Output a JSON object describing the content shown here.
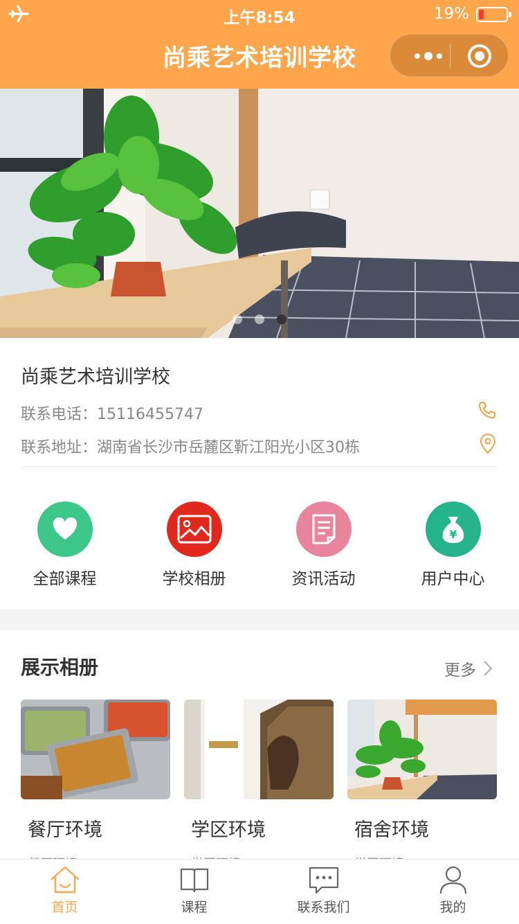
{
  "status_bar": {
    "time": "上午8:54",
    "battery": "19%",
    "battery_level": 0.19
  },
  "navbar": {
    "title": "尚乘艺术培训学校"
  },
  "colors": {
    "accent": "#ffa64d",
    "green": "#3cc68a",
    "red": "#e0281c",
    "pink": "#e8849b",
    "teal": "#25b38b"
  },
  "banner": {
    "slides": 3,
    "active_slide": 2
  },
  "school": {
    "name": "尚乘艺术培训学校",
    "phone_label": "联系电话：",
    "phone": "15116455747",
    "address_label": "联系地址：",
    "address": "湖南省长沙市岳麓区靳江阳光小区30栋"
  },
  "menu": [
    {
      "label": "全部课程",
      "icon": "heart-icon"
    },
    {
      "label": "学校相册",
      "icon": "picture-icon"
    },
    {
      "label": "资讯活动",
      "icon": "document-icon"
    },
    {
      "label": "用户中心",
      "icon": "money-bag-icon"
    }
  ],
  "album": {
    "title": "展示相册",
    "more": "更多",
    "items": [
      {
        "title": "餐厅环境",
        "subtitle": "餐厅环境"
      },
      {
        "title": "学区环境",
        "subtitle": "学区环境"
      },
      {
        "title": "宿舍环境",
        "subtitle": "学区环境"
      }
    ]
  },
  "tabbar": [
    {
      "label": "首页",
      "icon": "home-icon",
      "active": true
    },
    {
      "label": "课程",
      "icon": "book-icon",
      "active": false
    },
    {
      "label": "联系我们",
      "icon": "chat-icon",
      "active": false
    },
    {
      "label": "我的",
      "icon": "user-icon",
      "active": false
    }
  ]
}
